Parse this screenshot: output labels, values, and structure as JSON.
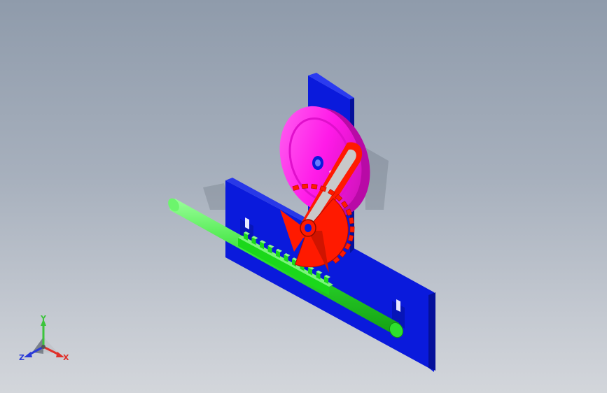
{
  "triad": {
    "labels": {
      "x": "X",
      "y": "Y",
      "z": "Z"
    },
    "colors": {
      "x": "#e0302a",
      "y": "#3cc43c",
      "z": "#2a3ad8"
    }
  },
  "colors": {
    "background_top": "#8f9bab",
    "background_bottom": "#d3d6db",
    "frame": "#0a1adc",
    "frame_dark": "#05109a",
    "shaft": "#2ee02e",
    "rack": "#1ad81a",
    "gear": "#ff1a00",
    "gear_dark": "#b00c00",
    "wheel": "#ff1ae8",
    "wheel_dark": "#b80aa6"
  }
}
